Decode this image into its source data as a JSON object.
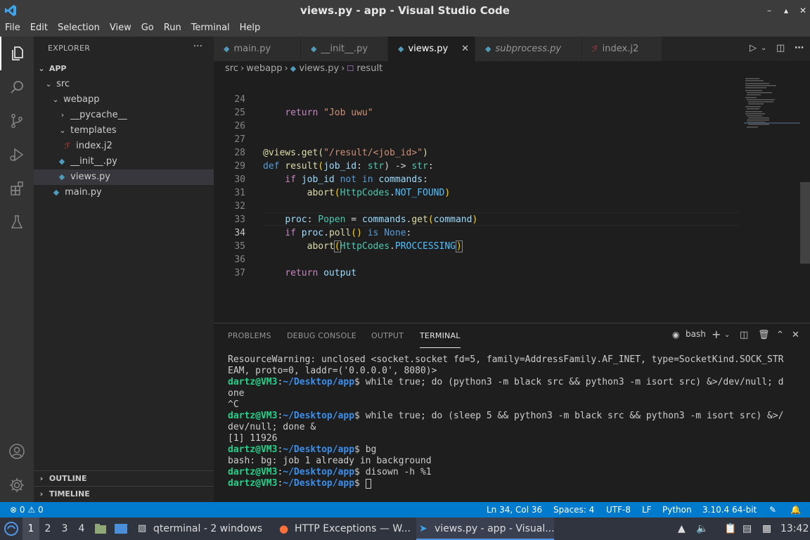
{
  "window": {
    "title": "views.py - app - Visual Studio Code",
    "controls": [
      "–",
      "▴",
      "✕"
    ]
  },
  "menubar": [
    "File",
    "Edit",
    "Selection",
    "View",
    "Go",
    "Run",
    "Terminal",
    "Help"
  ],
  "sidebar": {
    "header": "EXPLORER",
    "more": "···",
    "tree": [
      {
        "label": "APP",
        "kind": "root"
      },
      {
        "label": "src",
        "kind": "folder"
      },
      {
        "label": "webapp",
        "kind": "folder"
      },
      {
        "label": "__pycache__",
        "kind": "folder-closed"
      },
      {
        "label": "templates",
        "kind": "folder"
      },
      {
        "label": "index.j2",
        "kind": "j2"
      },
      {
        "label": "__init__.py",
        "kind": "py"
      },
      {
        "label": "views.py",
        "kind": "py",
        "selected": true
      },
      {
        "label": "main.py",
        "kind": "py"
      }
    ],
    "outline_label": "OUTLINE",
    "timeline_label": "TIMELINE"
  },
  "tabs": [
    {
      "label": "main.py",
      "icon": "python-icon"
    },
    {
      "label": "__init__.py",
      "icon": "python-icon"
    },
    {
      "label": "views.py",
      "icon": "python-icon",
      "active": true,
      "close": "✕"
    },
    {
      "label": "subprocess.py",
      "icon": "python-icon",
      "italic": true
    },
    {
      "label": "index.j2",
      "icon": "jinja-icon"
    }
  ],
  "breadcrumb": [
    "src",
    "webapp",
    "views.py",
    "result"
  ],
  "editor": {
    "line_numbers": [
      "24",
      "25",
      "26",
      "27",
      "28",
      "29",
      "30",
      "31",
      "32",
      "33",
      "34",
      "35",
      "36",
      "37"
    ],
    "current_line": "34",
    "code": {
      "l24": [
        "return",
        " ",
        "\"Job uwu\""
      ],
      "l27": [
        "@views.get(",
        "\"/result/<job_id>\"",
        ")"
      ],
      "l28": [
        "def",
        "result",
        "(",
        "job_id",
        ": ",
        "str",
        ") -> ",
        "str",
        ":"
      ],
      "l29": [
        "if",
        "job_id",
        "not",
        "in",
        "commands",
        ":"
      ],
      "l30": [
        "abort",
        "(",
        "HttpCodes",
        ".",
        "NOT_FOUND",
        ")"
      ],
      "l32": [
        "proc",
        ": ",
        "Popen",
        " = ",
        "commands",
        ".",
        "get",
        "(",
        "command",
        ")"
      ],
      "l33": [
        "if",
        "proc",
        ".",
        "poll",
        "() ",
        "is",
        "None",
        ":"
      ],
      "l34": [
        "abort",
        "(",
        "HttpCodes",
        ".",
        "PROCCESSING",
        ")"
      ],
      "l36": [
        "return",
        "output"
      ]
    }
  },
  "panel": {
    "tabs": [
      "PROBLEMS",
      "DEBUG CONSOLE",
      "OUTPUT",
      "TERMINAL"
    ],
    "active_tab": "TERMINAL",
    "shell": "bash",
    "terminal": {
      "line1": "ResourceWarning: unclosed <socket.socket fd=5, family=AddressFamily.AF_INET, type=SocketKind.SOCK_STR",
      "line2": "EAM, proto=0, laddr=('0.0.0.0', 8080)>",
      "prompt_user": "dartz@VM3",
      "prompt_colon": ":",
      "prompt_path": "~/Desktop/app",
      "prompt_dollar": "$ ",
      "cmd1": "while true; do (python3 -m black src && python3 -m isort src) &>/dev/null; d",
      "cmd1_cont": "one",
      "ctrl_c": "^C",
      "cmd2": "while true; do (sleep 5 && python3 -m black src && python3 -m isort src) &>/",
      "cmd2_cont": "dev/null; done &",
      "job": "[1] 11926",
      "cmd3": "bg",
      "bg_msg": "bash: bg: job 1 already in background",
      "cmd4": "disown -h %1"
    }
  },
  "statusbar": {
    "errors": "0",
    "warnings": "0",
    "position": "Ln 34, Col 36",
    "spaces": "Spaces: 4",
    "encoding": "UTF-8",
    "eol": "LF",
    "language": "Python",
    "interpreter": "3.10.4 64-bit"
  },
  "taskbar": {
    "workspaces": [
      "1",
      "2",
      "3",
      "4"
    ],
    "active_workspace": "1",
    "windows": [
      {
        "label": "qterminal - 2 windows",
        "icon": "terminal-icon"
      },
      {
        "label": "HTTP Exceptions — W...",
        "icon": "firefox-icon"
      },
      {
        "label": "views.py - app - Visual...",
        "icon": "vscode-icon",
        "active": true
      }
    ],
    "clock": "13:42"
  },
  "colors": {
    "accent": "#007acc",
    "editor_bg": "#1e1e1e",
    "sidebar_bg": "#252526",
    "prompt_green": "#23d18b",
    "prompt_blue": "#3b8eea"
  }
}
